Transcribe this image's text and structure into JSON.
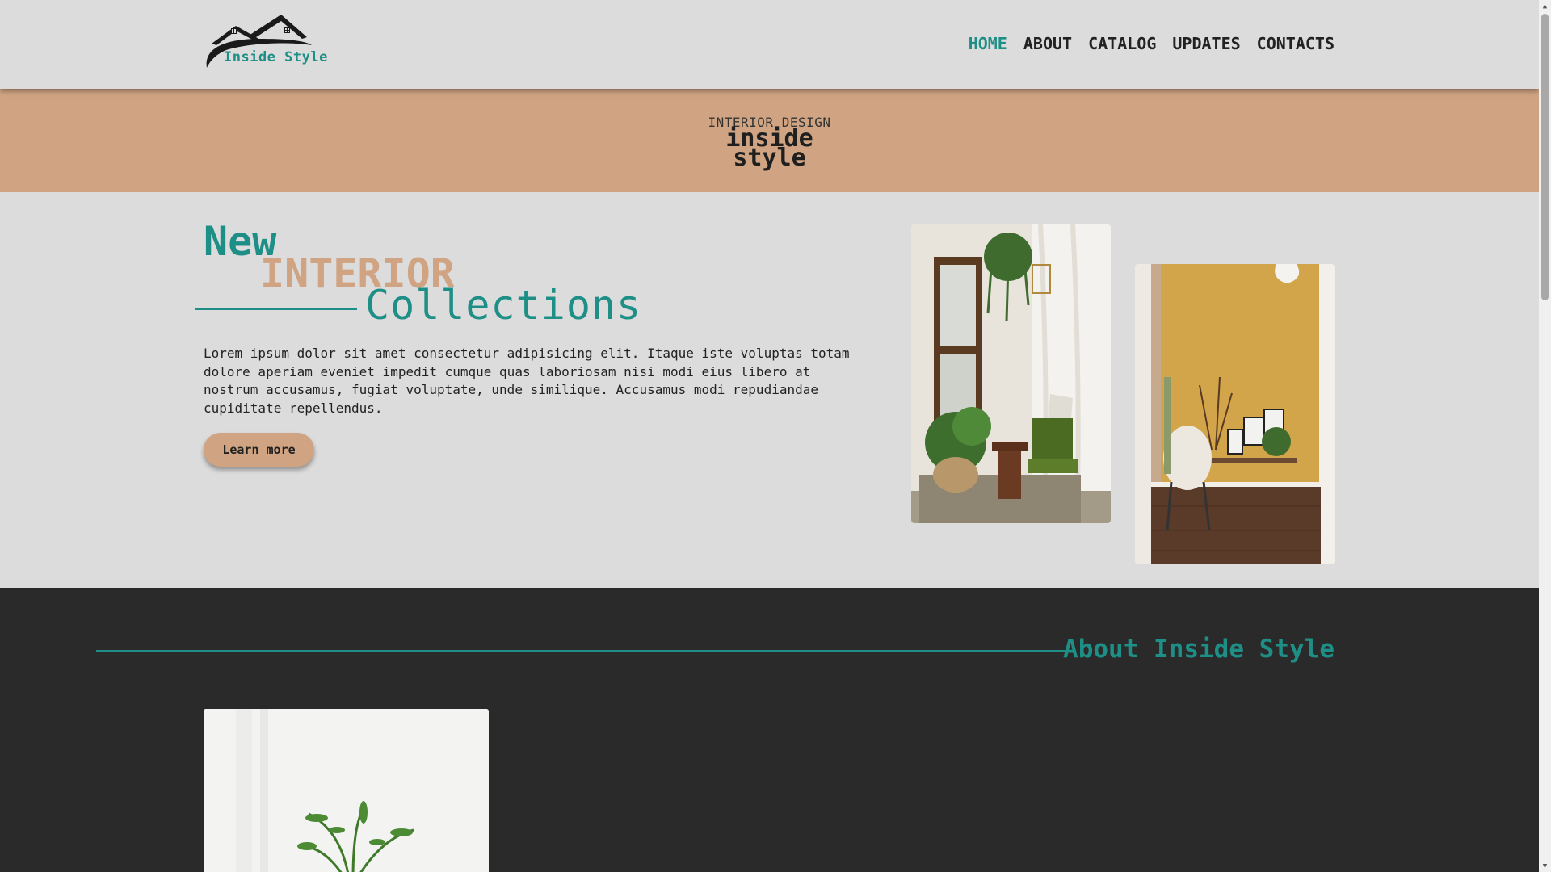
{
  "header": {
    "logo_text": "Inside Style",
    "nav": [
      {
        "label": "HOME",
        "active": true
      },
      {
        "label": "ABOUT"
      },
      {
        "label": "CATALOG"
      },
      {
        "label": "UPDATES"
      },
      {
        "label": "CONTACTS"
      }
    ]
  },
  "banner": {
    "kicker": "INTERIOR DESIGN",
    "brand_line1": "inside",
    "brand_line2": "style"
  },
  "hero": {
    "title_new": "New",
    "title_interior": "INTERIOR",
    "title_collections": "Collections",
    "body": "Lorem ipsum dolor sit amet consectetur adipisicing elit. Itaque iste voluptas totam dolore aperiam eveniet impedit cumque quas laboriosam nisi modi eius libero at nostrum accusamus, fugiat voluptate, unde similique. Accusamus modi repudiandae cupiditate repellendus.",
    "button": "Learn more"
  },
  "about": {
    "title": "About Inside Style"
  },
  "colors": {
    "teal": "#1e8f86",
    "tan": "#d0a482",
    "dark": "#2a2a2a",
    "light": "#dcdcdc"
  },
  "icons": [
    "house-logo-icon",
    "scroll-up-icon",
    "scroll-down-icon"
  ]
}
